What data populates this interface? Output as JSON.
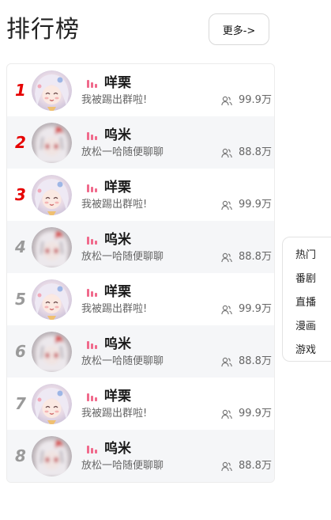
{
  "header": {
    "title": "排行榜",
    "more_label": "更多->"
  },
  "ranking": {
    "items": [
      {
        "rank": "1",
        "name": "咩栗",
        "desc": "我被踢出群啦!",
        "fans": "99.9万",
        "avatar": "white-hair-girl-avatar"
      },
      {
        "rank": "2",
        "name": "呜米",
        "desc": "放松一哈随便聊聊",
        "fans": "88.8万",
        "avatar": "red-eyed-girl-avatar"
      },
      {
        "rank": "3",
        "name": "咩栗",
        "desc": "我被踢出群啦!",
        "fans": "99.9万",
        "avatar": "white-hair-girl-avatar"
      },
      {
        "rank": "4",
        "name": "呜米",
        "desc": "放松一哈随便聊聊",
        "fans": "88.8万",
        "avatar": "red-eyed-girl-avatar"
      },
      {
        "rank": "5",
        "name": "咩栗",
        "desc": "我被踢出群啦!",
        "fans": "99.9万",
        "avatar": "white-hair-girl-avatar"
      },
      {
        "rank": "6",
        "name": "呜米",
        "desc": "放松一哈随便聊聊",
        "fans": "88.8万",
        "avatar": "red-eyed-girl-avatar"
      },
      {
        "rank": "7",
        "name": "咩栗",
        "desc": "我被踢出群啦!",
        "fans": "99.9万",
        "avatar": "white-hair-girl-avatar"
      },
      {
        "rank": "8",
        "name": "呜米",
        "desc": "放松一哈随便聊聊",
        "fans": "88.8万",
        "avatar": "red-eyed-girl-avatar"
      }
    ],
    "icons": {
      "level": "bars-icon",
      "fans": "fans-icon"
    }
  },
  "side_menu": {
    "items": [
      "热门",
      "番剧",
      "直播",
      "漫画",
      "游戏"
    ]
  },
  "colors": {
    "top_rank": "#e60000",
    "rank": "#9a9a9a",
    "level_icon": "#f06a8c",
    "alt_row": "#f5f6f8"
  }
}
